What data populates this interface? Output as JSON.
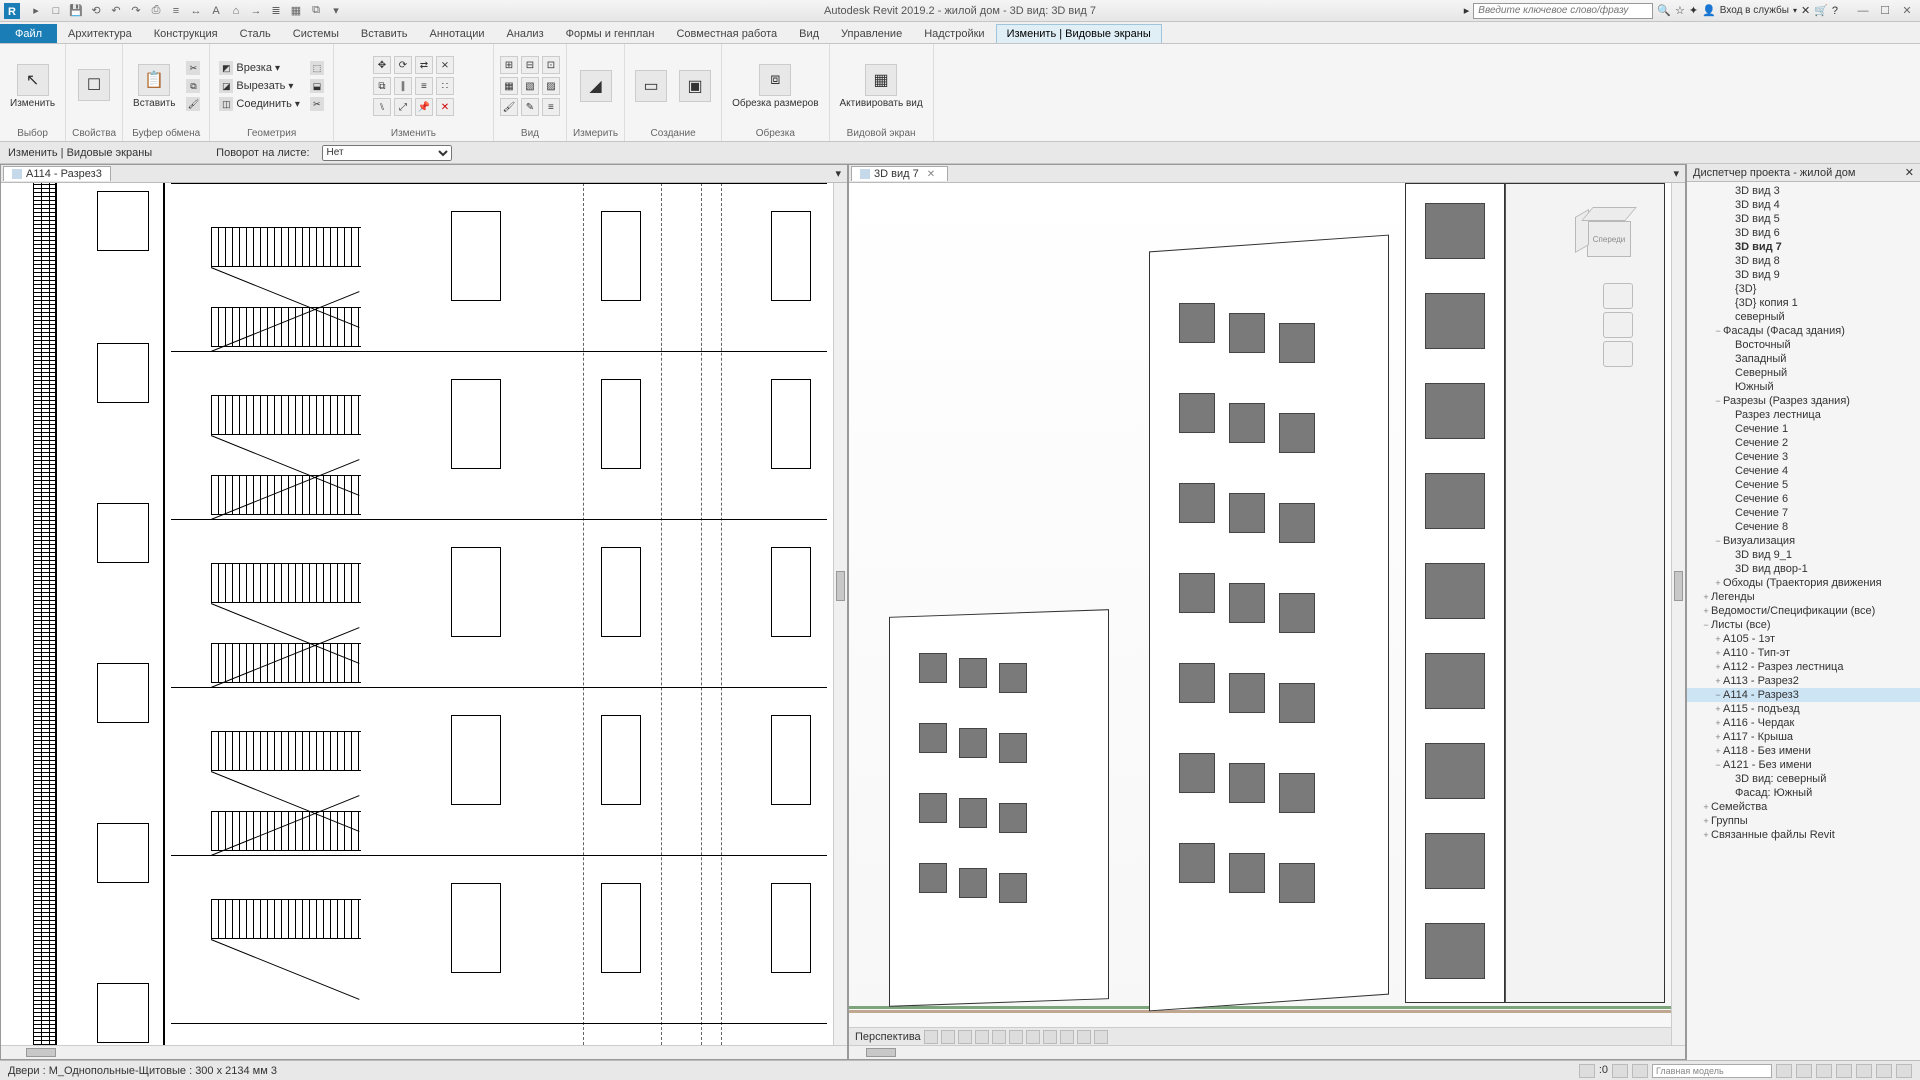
{
  "app": {
    "title": "Autodesk Revit 2019.2 - жилой дом - 3D вид: 3D вид 7",
    "search_placeholder": "Введите ключевое слово/фразу",
    "signin": "Вход в службы"
  },
  "qat_icons": [
    "open",
    "save",
    "undo",
    "redo",
    "sep",
    "print",
    "measure",
    "sep2",
    "text",
    "home",
    "arrow",
    "thin",
    "grid",
    "sep3",
    "dd"
  ],
  "tabs": {
    "file": "Файл",
    "items": [
      "Архитектура",
      "Конструкция",
      "Сталь",
      "Системы",
      "Вставить",
      "Аннотации",
      "Анализ",
      "Формы и генплан",
      "Совместная работа",
      "Вид",
      "Управление",
      "Надстройки",
      "Изменить | Видовые экраны"
    ],
    "active": "Изменить | Видовые экраны"
  },
  "ribbon": {
    "modify": {
      "label": "Изменить",
      "btn": "Изменить"
    },
    "select": "Выбор",
    "properties": "Свойства",
    "paste": "Вставить",
    "clipboard": "Буфер обмена",
    "geom_btns": {
      "cut": "Врезка",
      "cutout": "Вырезать",
      "join": "Соединить"
    },
    "geometry": "Геометрия",
    "modify2": "Изменить",
    "view": "Вид",
    "measure": "Измерить",
    "create": "Создание",
    "crop": "Обрезка",
    "crop_size": "Обрезка размеров",
    "activate": "Активировать вид",
    "viewport": "Видовой экран"
  },
  "options": {
    "context": "Изменить | Видовые экраны",
    "rotation_label": "Поворот на листе:",
    "rotation_value": "Нет"
  },
  "views": {
    "left_tab": "A114 - Разрез3",
    "right_tab": "3D вид 7",
    "perspective": "Перспектива"
  },
  "browser": {
    "title": "Диспетчер проекта - жилой дом",
    "cube_front": "Спереди",
    "nodes": [
      {
        "d": 3,
        "e": "",
        "t": "3D вид 3"
      },
      {
        "d": 3,
        "e": "",
        "t": "3D вид 4"
      },
      {
        "d": 3,
        "e": "",
        "t": "3D вид 5"
      },
      {
        "d": 3,
        "e": "",
        "t": "3D вид 6"
      },
      {
        "d": 3,
        "e": "",
        "t": "3D вид 7",
        "bold": true
      },
      {
        "d": 3,
        "e": "",
        "t": "3D вид 8"
      },
      {
        "d": 3,
        "e": "",
        "t": "3D вид 9"
      },
      {
        "d": 3,
        "e": "",
        "t": "{3D}"
      },
      {
        "d": 3,
        "e": "",
        "t": "{3D} копия 1"
      },
      {
        "d": 3,
        "e": "",
        "t": "северный"
      },
      {
        "d": 2,
        "e": "−",
        "t": "Фасады (Фасад здания)"
      },
      {
        "d": 3,
        "e": "",
        "t": "Восточный"
      },
      {
        "d": 3,
        "e": "",
        "t": "Западный"
      },
      {
        "d": 3,
        "e": "",
        "t": "Северный"
      },
      {
        "d": 3,
        "e": "",
        "t": "Южный"
      },
      {
        "d": 2,
        "e": "−",
        "t": "Разрезы (Разрез здания)"
      },
      {
        "d": 3,
        "e": "",
        "t": "Разрез лестница"
      },
      {
        "d": 3,
        "e": "",
        "t": "Сечение 1"
      },
      {
        "d": 3,
        "e": "",
        "t": "Сечение 2"
      },
      {
        "d": 3,
        "e": "",
        "t": "Сечение 3"
      },
      {
        "d": 3,
        "e": "",
        "t": "Сечение 4"
      },
      {
        "d": 3,
        "e": "",
        "t": "Сечение 5"
      },
      {
        "d": 3,
        "e": "",
        "t": "Сечение 6"
      },
      {
        "d": 3,
        "e": "",
        "t": "Сечение 7"
      },
      {
        "d": 3,
        "e": "",
        "t": "Сечение 8"
      },
      {
        "d": 2,
        "e": "−",
        "t": "Визуализация"
      },
      {
        "d": 3,
        "e": "",
        "t": "3D вид 9_1"
      },
      {
        "d": 3,
        "e": "",
        "t": "3D вид двор-1"
      },
      {
        "d": 2,
        "e": "+",
        "t": "Обходы (Траектория движения"
      },
      {
        "d": 1,
        "e": "+",
        "t": "Легенды"
      },
      {
        "d": 1,
        "e": "+",
        "t": "Ведомости/Спецификации (все)"
      },
      {
        "d": 1,
        "e": "−",
        "t": "Листы (все)"
      },
      {
        "d": 2,
        "e": "+",
        "t": "A105 - 1эт"
      },
      {
        "d": 2,
        "e": "+",
        "t": "A110 - Тип-эт"
      },
      {
        "d": 2,
        "e": "+",
        "t": "A112 - Разрез лестница"
      },
      {
        "d": 2,
        "e": "+",
        "t": "A113 - Разрез2"
      },
      {
        "d": 2,
        "e": "−",
        "t": "A114 - Разрез3",
        "sel": true
      },
      {
        "d": 2,
        "e": "+",
        "t": "A115 - подъезд"
      },
      {
        "d": 2,
        "e": "+",
        "t": "A116 - Чердак"
      },
      {
        "d": 2,
        "e": "+",
        "t": "A117 - Крыша"
      },
      {
        "d": 2,
        "e": "+",
        "t": "A118 - Без имени"
      },
      {
        "d": 2,
        "e": "−",
        "t": "A121 - Без имени"
      },
      {
        "d": 3,
        "e": "",
        "t": "3D вид: северный"
      },
      {
        "d": 3,
        "e": "",
        "t": "Фасад: Южный"
      },
      {
        "d": 1,
        "e": "+",
        "t": "Семейства"
      },
      {
        "d": 1,
        "e": "+",
        "t": "Группы"
      },
      {
        "d": 1,
        "e": "+",
        "t": "Связанные файлы Revit"
      }
    ]
  },
  "status": {
    "hint": "Двери : M_Однопольные-Щитовые : 300 x 2134 мм 3",
    "selcount": ":0",
    "model": "Главная модель"
  }
}
